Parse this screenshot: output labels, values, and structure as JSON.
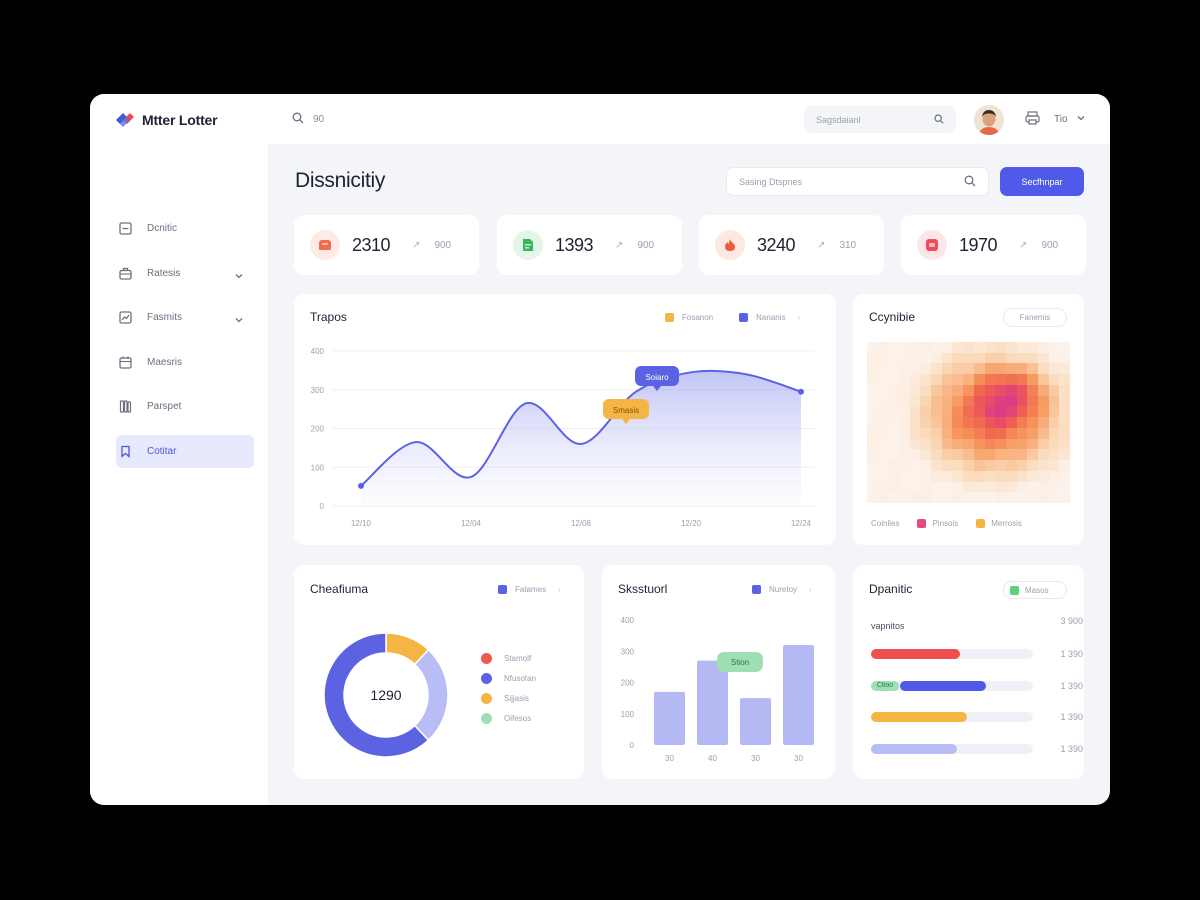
{
  "app": {
    "name": "Mtter Lotter"
  },
  "sidebar": {
    "items": [
      {
        "label": "Dcnitic",
        "icon": "dashboard-icon",
        "has_chevron": false,
        "active": false
      },
      {
        "label": "Ratesis",
        "icon": "briefcase-icon",
        "has_chevron": true,
        "active": false
      },
      {
        "label": "Fasmits",
        "icon": "chart-icon",
        "has_chevron": true,
        "active": false
      },
      {
        "label": "Maesris",
        "icon": "calendar-icon",
        "has_chevron": false,
        "active": false
      },
      {
        "label": "Parspet",
        "icon": "library-icon",
        "has_chevron": false,
        "active": false
      },
      {
        "label": "Cotitar",
        "icon": "bookmark-icon",
        "has_chevron": false,
        "active": true
      }
    ]
  },
  "topbar": {
    "search_label": "90",
    "field_placeholder": "Sagsdaianl",
    "user_label": "Tio"
  },
  "header": {
    "title": "Dissnicitiy",
    "search_placeholder": "Sasing Dtspnes",
    "primary_button": "Secfhnpar"
  },
  "stats": [
    {
      "value": "2310",
      "sub": "900",
      "icon": "box-icon",
      "color": "#f26b4e",
      "bg": "#fdece6"
    },
    {
      "value": "1393",
      "sub": "900",
      "icon": "document-icon",
      "color": "#3cb55e",
      "bg": "#e4f6e9"
    },
    {
      "value": "3240",
      "sub": "310",
      "icon": "flame-icon",
      "color": "#ef5a3a",
      "bg": "#fde8e2"
    },
    {
      "value": "1970",
      "sub": "900",
      "icon": "tag-icon",
      "color": "#ec4d5c",
      "bg": "#fde6e8"
    }
  ],
  "trends": {
    "title": "Trapos",
    "legend": [
      {
        "label": "Fosanon",
        "color": "#f5b545"
      },
      {
        "label": "Nananis",
        "color": "#5b63e3"
      }
    ],
    "callouts": [
      {
        "label": "Soiaro",
        "color": "#5b63e3"
      },
      {
        "label": "Smasis",
        "color": "#f5b545"
      }
    ]
  },
  "heat": {
    "title": "Ccynibie",
    "pill": "Fanemis",
    "legend": [
      {
        "label": "Coinlies",
        "color": "#f2a38a"
      },
      {
        "label": "Pinsois",
        "color": "#e84a7a"
      },
      {
        "label": "Merrosis",
        "color": "#f5b545"
      }
    ]
  },
  "donut": {
    "title": "Cheafiuma",
    "legend_header": "Fatames",
    "center": "1290",
    "items": [
      {
        "label": "Stamolf",
        "color": "#ee5a4f"
      },
      {
        "label": "Nfusotan",
        "color": "#5b63e3"
      },
      {
        "label": "Sijjasis",
        "color": "#f5b545"
      },
      {
        "label": "Oifesos",
        "color": "#9ee0b4"
      }
    ]
  },
  "bars": {
    "title": "Sksstuorl",
    "legend": "Nuretoy",
    "tag": "Stion",
    "legend_color": "#5b63e3"
  },
  "list": {
    "title": "Dpanitic",
    "legend": "Masos",
    "header": "vapnitos",
    "header_value": "3 900",
    "tag": "Ctioo",
    "rows": [
      {
        "value": "1 390",
        "fill": 0.55,
        "color": "#ee5050",
        "start": 0
      },
      {
        "value": "1 390",
        "fill": 0.53,
        "color": "#4f5be8",
        "start": 0.18
      },
      {
        "value": "1 390",
        "fill": 0.59,
        "color": "#f5b545",
        "start": 0
      },
      {
        "value": "1 390",
        "fill": 0.53,
        "color": "#b9bdf5",
        "start": 0
      }
    ]
  },
  "chart_data": [
    {
      "type": "area",
      "title": "Trapos",
      "x": [
        "12/10",
        "12/04",
        "12/08",
        "12/20",
        "12/24"
      ],
      "x_points": [
        0,
        0.5,
        1,
        1.5,
        2,
        2.5,
        3,
        3.5,
        4
      ],
      "y_points": [
        52,
        165,
        75,
        265,
        160,
        295,
        345,
        340,
        295
      ],
      "y_ticks": [
        "0",
        "100",
        "200",
        "300",
        "400"
      ],
      "ylim": [
        0,
        400
      ],
      "series": [
        {
          "name": "Nananis",
          "color": "#5b63e3"
        }
      ],
      "grid": true
    },
    {
      "type": "pie",
      "title": "Cheafiuma",
      "center_label": "1290",
      "values": [
        12,
        26,
        62
      ],
      "colors": [
        "#f5b545",
        "#b9bdf5",
        "#5b63e3"
      ]
    },
    {
      "type": "bar",
      "title": "Sksstuorl",
      "categories": [
        "30",
        "40",
        "30",
        "30"
      ],
      "values": [
        170,
        270,
        150,
        320
      ],
      "y_ticks": [
        "0",
        "100",
        "200",
        "300",
        "400"
      ],
      "ylim": [
        0,
        400
      ],
      "series": [
        {
          "name": "Nuretoy",
          "color": "#b4b9f4"
        }
      ]
    },
    {
      "type": "heatmap",
      "title": "Ccynibie"
    }
  ]
}
